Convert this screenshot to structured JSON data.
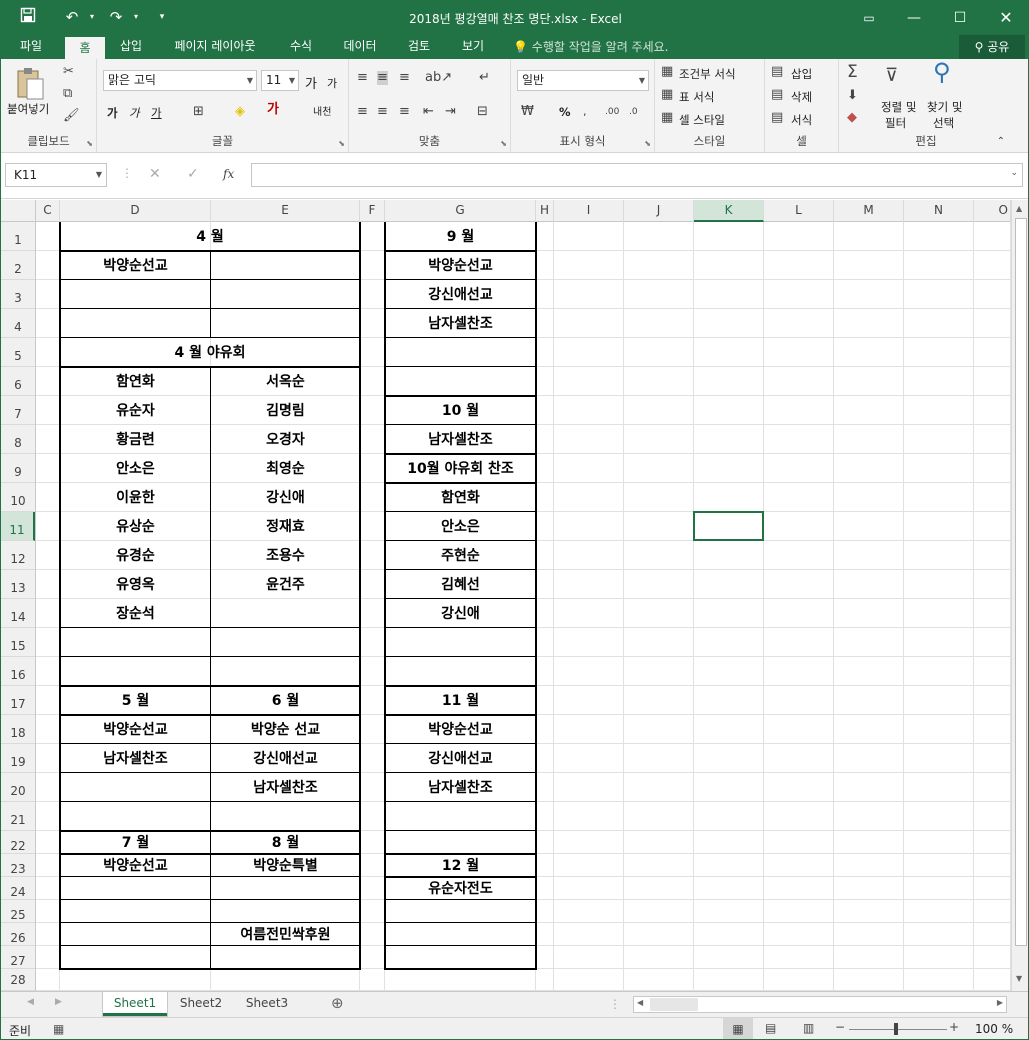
{
  "window": {
    "title": "2018년 평강열매 찬조 명단.xlsx - Excel",
    "minimize_icon": "minimize-icon",
    "maximize_icon": "maximize-icon",
    "close_icon": "close-icon",
    "ribbon_display_icon": "ribbon-display-icon"
  },
  "quick_access": {
    "save_icon": "save-icon",
    "undo_icon": "undo-icon",
    "redo_icon": "redo-icon",
    "customize_icon": "customize-icon"
  },
  "tabs": [
    "파일",
    "홈",
    "삽입",
    "페이지 레이아웃",
    "수식",
    "데이터",
    "검토",
    "보기"
  ],
  "active_tab": "홈",
  "tell_me": "수행할 작업을 알려 주세요.",
  "share": "공유",
  "ribbon": {
    "clipboard": {
      "paste": "붙여넣기",
      "label": "클립보드"
    },
    "font": {
      "name": "맑은 고딕",
      "size": "11",
      "label": "글꼴",
      "bold": "가",
      "italic": "가",
      "underline": "가",
      "grow": "가",
      "shrink": "가",
      "phonetic": "내천"
    },
    "alignment": {
      "label": "맞춤"
    },
    "number": {
      "format": "일반",
      "label": "표시 형식",
      "percent": "%"
    },
    "styles": {
      "conditional": "조건부 서식",
      "table": "표 서식",
      "cell": "셀 스타일",
      "label": "스타일"
    },
    "cells": {
      "insert": "삽입",
      "delete": "삭제",
      "format": "서식",
      "label": "셀"
    },
    "editing": {
      "sort1": "정렬 및",
      "sort2": "필터",
      "find1": "찾기 및",
      "find2": "선택",
      "label": "편집"
    }
  },
  "formula_bar": {
    "name_box": "K11",
    "fx": "fx",
    "formula": ""
  },
  "columns": [
    "C",
    "D",
    "E",
    "F",
    "G",
    "H",
    "I",
    "J",
    "K",
    "L",
    "M",
    "N",
    "O"
  ],
  "selected_column": "K",
  "selected_row": "11",
  "rows": [
    "1",
    "2",
    "3",
    "4",
    "5",
    "6",
    "7",
    "8",
    "9",
    "10",
    "11",
    "12",
    "13",
    "14",
    "15",
    "16",
    "17",
    "18",
    "19",
    "20",
    "21",
    "22",
    "23",
    "24",
    "25",
    "26",
    "27",
    "28"
  ],
  "sheet": {
    "D1": "4 월",
    "D2": "박양순선교",
    "D5": "4 월 야유회",
    "D6": "함연화",
    "E6": "서옥순",
    "D7": "유순자",
    "E7": "김명림",
    "D8": "황금련",
    "E8": "오경자",
    "D9": "안소은",
    "E9": "최영순",
    "D10": "이윤한",
    "E10": "강신애",
    "D11": "유상순",
    "E11": "정재효",
    "D12": "유경순",
    "E12": "조용수",
    "D13": "유영옥",
    "E13": "윤건주",
    "D14": "장순석",
    "D17": "5 월",
    "E17": "6 월",
    "D18": "박양순선교",
    "E18": "박양순 선교",
    "D19": "남자셀찬조",
    "E19": "강신애선교",
    "E20": "남자셀찬조",
    "D22": "7 월",
    "E22": "8 월",
    "D23": "박양순선교",
    "E23": "박양순특별",
    "E26": "여름전민싹후원",
    "G1": "9  월",
    "G2": "박양순선교",
    "G3": "강신애선교",
    "G4": "남자셀찬조",
    "G7": "10 월",
    "G8": "남자셀찬조",
    "G9": "10월 야유회 찬조",
    "G10": "함연화",
    "G11": "안소은",
    "G12": "주현순",
    "G13": "김혜선",
    "G14": "강신애",
    "G17": "11  월",
    "G18": "박양순선교",
    "G19": "강신애선교",
    "G20": "남자셀찬조",
    "G23": "12 월",
    "G24": "유순자전도"
  },
  "sheet_tabs": [
    "Sheet1",
    "Sheet2",
    "Sheet3"
  ],
  "active_sheet": "Sheet1",
  "status": {
    "ready": "준비",
    "zoom": "100 %"
  }
}
